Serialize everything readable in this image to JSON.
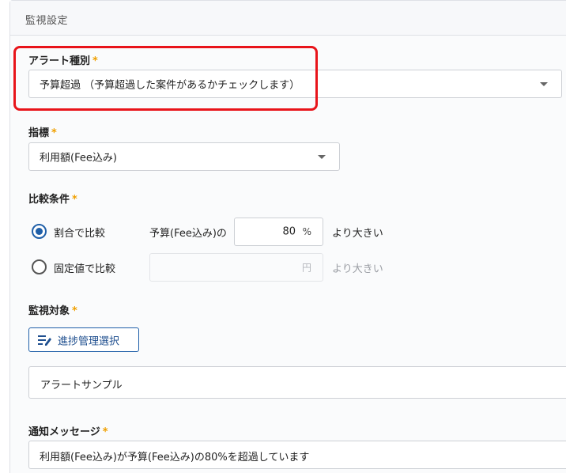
{
  "panel": {
    "title": "監視設定"
  },
  "alert_type": {
    "label": "アラート種別",
    "required_mark": "*",
    "value": "予算超過 （予算超過した案件があるかチェックします）"
  },
  "metric": {
    "label": "指標",
    "required_mark": "*",
    "value": "利用額(Fee込み)"
  },
  "comparison": {
    "label": "比較条件",
    "required_mark": "*",
    "ratio": {
      "option_label": "割合で比較",
      "selected": true,
      "prefix": "予算(Fee込み)の",
      "value": "80",
      "unit": "%",
      "suffix": "より大きい"
    },
    "fixed": {
      "option_label": "固定値で比較",
      "selected": false,
      "value": "",
      "unit": "円",
      "suffix": "より大きい"
    }
  },
  "target": {
    "label": "監視対象",
    "required_mark": "*",
    "button_label": "進捗管理選択",
    "selected_value": "アラートサンプル"
  },
  "message": {
    "label": "通知メッセージ",
    "required_mark": "*",
    "value": "利用額(Fee込み)が予算(Fee込み)の80%を超過しています"
  },
  "colors": {
    "highlight": "#e8141a",
    "accent": "#1f5fa8",
    "required": "#f0a000"
  }
}
